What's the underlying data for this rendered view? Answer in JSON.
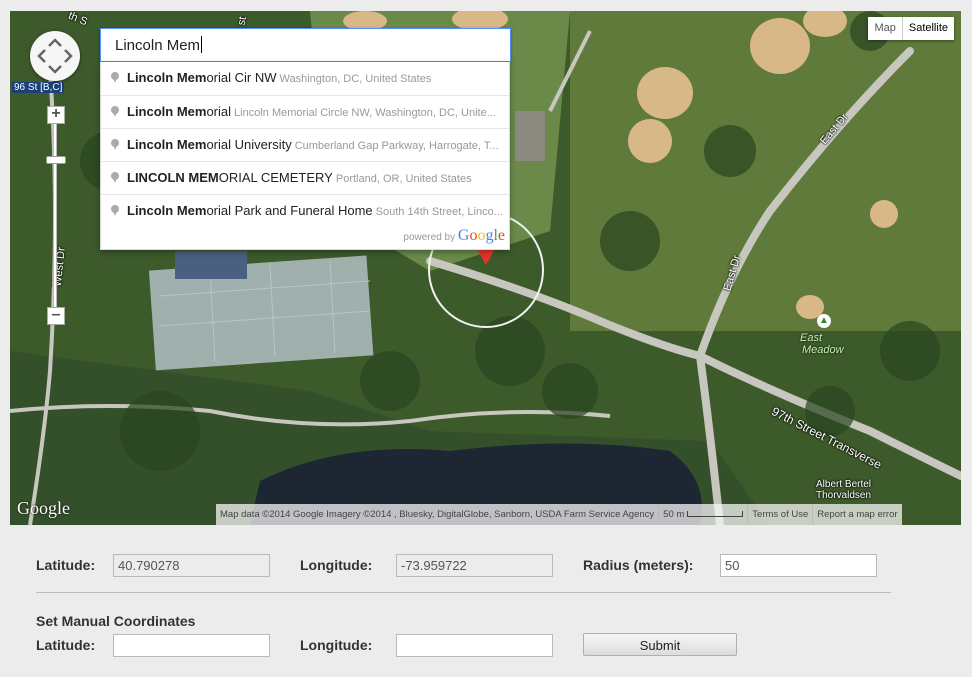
{
  "map": {
    "search": {
      "typed_bold": "Lincoln Mem"
    },
    "suggestions": [
      {
        "match": "Lincoln Mem",
        "rest": "orial Cir NW",
        "secondary": "Washington, DC, United States"
      },
      {
        "match": "Lincoln Mem",
        "rest": "orial",
        "secondary": "Lincoln Memorial Circle NW, Washington, DC, Unite..."
      },
      {
        "match": "Lincoln Mem",
        "rest": "orial University",
        "secondary": "Cumberland Gap Parkway, Harrogate, T..."
      },
      {
        "match": "LINCOLN MEM",
        "rest": "ORIAL CEMETERY",
        "secondary": "Portland, OR, United States"
      },
      {
        "match": "Lincoln Mem",
        "rest": "orial Park and Funeral Home",
        "secondary": "South 14th Street, Linco..."
      }
    ],
    "powered_by": "powered by",
    "google_brand": [
      "G",
      "o",
      "o",
      "g",
      "l",
      "e"
    ],
    "map_type": {
      "map": "Map",
      "satellite": "Satellite"
    },
    "labels": {
      "street_1": "96 St [B,C]",
      "west_dr": "West Dr",
      "east_dr": "East Dr",
      "east_dr_2": "East Dr",
      "east_meadow_1": "East",
      "east_meadow_2": "Meadow",
      "transverse": "97th Street Transverse",
      "statue_1": "Albert Bertel",
      "statue_2": "Thorvaldsen",
      "top_street_1": "th S",
      "top_street_2": "st"
    },
    "google_logo": "Google",
    "attribution": {
      "map_data": "Map data ©2014 Google Imagery ©2014 , Bluesky, DigitalGlobe, Sanborn, USDA Farm Service Agency",
      "scale": "50 m",
      "terms": "Terms of Use",
      "report": "Report a map error"
    },
    "colors": {
      "marker": "#e5352b",
      "search_border": "#4d90fe"
    }
  },
  "form": {
    "latitude_label": "Latitude:",
    "latitude_value": "40.790278",
    "longitude_label": "Longitude:",
    "longitude_value": "-73.959722",
    "radius_label": "Radius (meters):",
    "radius_value": "50",
    "manual_title": "Set Manual Coordinates",
    "manual_lat_label": "Latitude:",
    "manual_lat_value": "",
    "manual_lng_label": "Longitude:",
    "manual_lng_value": "",
    "submit_label": "Submit"
  }
}
